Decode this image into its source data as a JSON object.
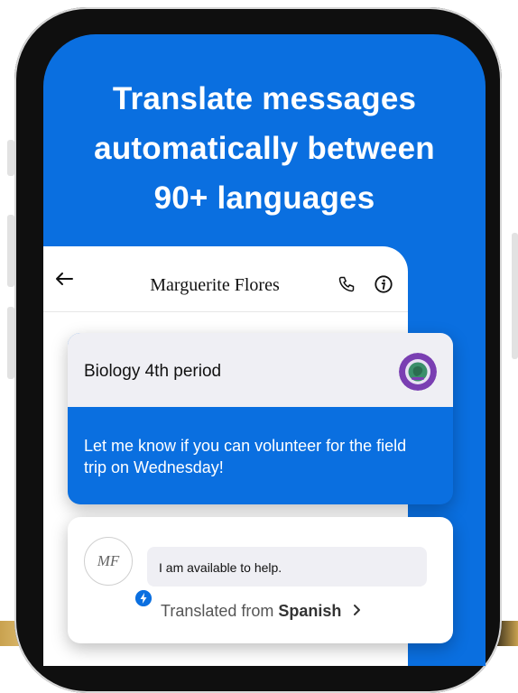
{
  "headline": {
    "line1": "Translate messages",
    "line2": "automatically between",
    "line3": "90+ languages"
  },
  "app": {
    "contact_name": "Marguerite Flores"
  },
  "group_message": {
    "title": "Biology 4th period",
    "text": "Let me know if you can volunteer for the field trip on Wednesday!"
  },
  "reply": {
    "avatar_initials": "MF",
    "text": "I am available to help.",
    "translated_prefix": "Translated from",
    "translated_language": "Spanish"
  },
  "colors": {
    "accent": "#0a6fe0",
    "bubble_bg": "#efeff4",
    "avatar_purple": "#7a3fb2",
    "avatar_green": "#3b8f6a"
  },
  "icons": {
    "back": "arrow-left-icon",
    "call": "phone-icon",
    "info": "info-icon",
    "chevron": "chevron-right-icon",
    "badge": "lightning-badge-icon"
  }
}
